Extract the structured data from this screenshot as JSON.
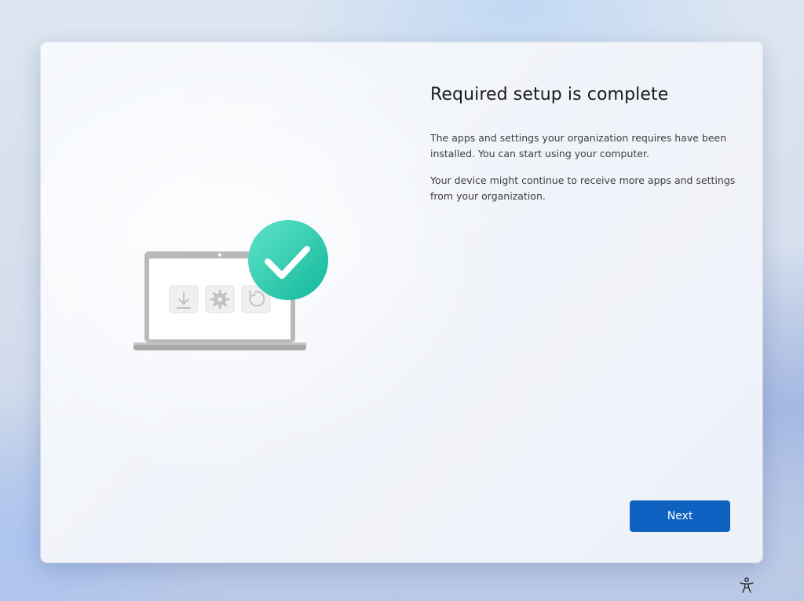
{
  "dialog": {
    "title": "Required setup is complete",
    "paragraphs": [
      "The apps and settings your organization requires have been installed. You can start using your computer.",
      "Your device might continue to receive more apps and settings from your organization."
    ],
    "next_label": "Next"
  },
  "illustration": {
    "icons": [
      "download-icon",
      "gear-icon",
      "refresh-icon",
      "checkmark-icon"
    ],
    "check_color": "#1fc4a4"
  },
  "footer": {
    "accessibility_icon": "accessibility-icon"
  },
  "colors": {
    "accent": "#0f62c1",
    "title_text": "#1b1b1b",
    "body_text": "#3d3d3d"
  }
}
